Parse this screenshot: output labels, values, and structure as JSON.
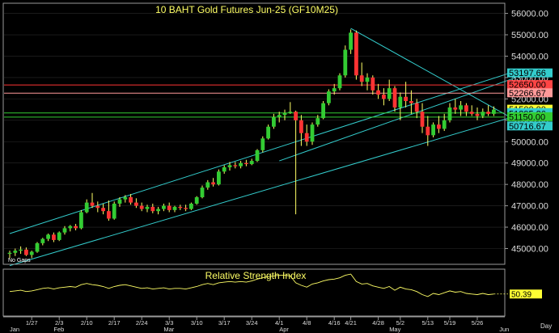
{
  "colors": {
    "background": "#000000",
    "frame": "#9a9a9a",
    "grid": "#2a2a2a",
    "title": "#ffff66",
    "up": "#33cc33",
    "down": "#ff3333",
    "wick": "#ffff66",
    "channel": "#33cccc",
    "rsi": "#ffff66",
    "axisText": "#dddddd",
    "badgeCyan": "#33cccc",
    "badgeRed": "#ff4444",
    "badgePink": "#ff9999",
    "badgeYellow": "#ffff33",
    "badgeGreen": "#33cc33"
  },
  "chart_data": {
    "type": "candlestick",
    "title": "10  BAHT  Gold  Futures  Jun-25  (GF10M25)",
    "corner_label": "No  Gaps",
    "ylim": [
      44300,
      56400
    ],
    "y_ticks": [
      45000,
      46000,
      47000,
      48000,
      49000,
      50000,
      51000,
      52000,
      53000,
      54000,
      55000,
      56000
    ],
    "y_tick_labels": [
      "45000.00",
      "46000.00",
      "47000.00",
      "48000.00",
      "49000.00",
      "50000.00",
      "51000.00",
      "52000.00",
      "53000.00",
      "54000.00",
      "55000.00",
      "56000.00"
    ],
    "x_ticks": [
      {
        "label": "1/27",
        "i": 4
      },
      {
        "label": "2/3",
        "i": 9
      },
      {
        "label": "2/10",
        "i": 14
      },
      {
        "label": "2/17",
        "i": 19
      },
      {
        "label": "2/24",
        "i": 24
      },
      {
        "label": "3/3",
        "i": 29
      },
      {
        "label": "3/10",
        "i": 34
      },
      {
        "label": "3/17",
        "i": 39
      },
      {
        "label": "3/24",
        "i": 44
      },
      {
        "label": "4/1",
        "i": 49
      },
      {
        "label": "4/8",
        "i": 54
      },
      {
        "label": "4/16",
        "i": 59
      },
      {
        "label": "4/21",
        "i": 62
      },
      {
        "label": "4/28",
        "i": 67
      },
      {
        "label": "5/2",
        "i": 71
      },
      {
        "label": "5/13",
        "i": 76
      },
      {
        "label": "5/19",
        "i": 80
      },
      {
        "label": "5/26",
        "i": 85
      }
    ],
    "month_labels": [
      {
        "label": "Jan",
        "i": 0
      },
      {
        "label": "Feb",
        "i": 8
      },
      {
        "label": "Mar",
        "i": 28
      },
      {
        "label": "Apr",
        "i": 49
      },
      {
        "label": "May",
        "i": 69
      },
      {
        "label": "Jun",
        "i": 89
      }
    ],
    "period_label": "Day",
    "candles": [
      {
        "o": 44750,
        "h": 44900,
        "l": 44550,
        "c": 44800
      },
      {
        "o": 44800,
        "h": 45000,
        "l": 44650,
        "c": 44900
      },
      {
        "o": 44900,
        "h": 45100,
        "l": 44750,
        "c": 44950
      },
      {
        "o": 44950,
        "h": 45050,
        "l": 44650,
        "c": 44700
      },
      {
        "o": 44700,
        "h": 44900,
        "l": 44550,
        "c": 44850
      },
      {
        "o": 44850,
        "h": 45300,
        "l": 44800,
        "c": 45250
      },
      {
        "o": 45250,
        "h": 45500,
        "l": 45150,
        "c": 45450
      },
      {
        "o": 45450,
        "h": 45700,
        "l": 45350,
        "c": 45650
      },
      {
        "o": 45650,
        "h": 45750,
        "l": 45300,
        "c": 45400
      },
      {
        "o": 45400,
        "h": 45800,
        "l": 45350,
        "c": 45750
      },
      {
        "o": 45750,
        "h": 46050,
        "l": 45650,
        "c": 45950
      },
      {
        "o": 45950,
        "h": 46100,
        "l": 45800,
        "c": 46050
      },
      {
        "o": 46050,
        "h": 46150,
        "l": 45850,
        "c": 45950
      },
      {
        "o": 45950,
        "h": 46800,
        "l": 45900,
        "c": 46700
      },
      {
        "o": 46700,
        "h": 47300,
        "l": 46650,
        "c": 47150
      },
      {
        "o": 47150,
        "h": 47600,
        "l": 46900,
        "c": 47000
      },
      {
        "o": 47000,
        "h": 47200,
        "l": 46700,
        "c": 46900
      },
      {
        "o": 46900,
        "h": 47100,
        "l": 46600,
        "c": 46750
      },
      {
        "o": 46750,
        "h": 47250,
        "l": 46300,
        "c": 46400
      },
      {
        "o": 46400,
        "h": 47200,
        "l": 46350,
        "c": 47100
      },
      {
        "o": 47100,
        "h": 47400,
        "l": 46950,
        "c": 47300
      },
      {
        "o": 47300,
        "h": 47500,
        "l": 47150,
        "c": 47400
      },
      {
        "o": 47400,
        "h": 47550,
        "l": 47050,
        "c": 47150
      },
      {
        "o": 47150,
        "h": 47350,
        "l": 46900,
        "c": 47000
      },
      {
        "o": 47000,
        "h": 47150,
        "l": 46750,
        "c": 46850
      },
      {
        "o": 46850,
        "h": 47050,
        "l": 46700,
        "c": 46950
      },
      {
        "o": 46950,
        "h": 47100,
        "l": 46650,
        "c": 46750
      },
      {
        "o": 46750,
        "h": 46950,
        "l": 46600,
        "c": 46850
      },
      {
        "o": 46850,
        "h": 47100,
        "l": 46750,
        "c": 47000
      },
      {
        "o": 47000,
        "h": 47150,
        "l": 46700,
        "c": 46800
      },
      {
        "o": 46800,
        "h": 47000,
        "l": 46700,
        "c": 46950
      },
      {
        "o": 46950,
        "h": 47050,
        "l": 46800,
        "c": 46900
      },
      {
        "o": 46900,
        "h": 47050,
        "l": 46750,
        "c": 46850
      },
      {
        "o": 46850,
        "h": 47150,
        "l": 46800,
        "c": 47100
      },
      {
        "o": 47100,
        "h": 47450,
        "l": 47050,
        "c": 47400
      },
      {
        "o": 47400,
        "h": 47950,
        "l": 47350,
        "c": 47850
      },
      {
        "o": 47850,
        "h": 48200,
        "l": 47750,
        "c": 48100
      },
      {
        "o": 48100,
        "h": 48300,
        "l": 47900,
        "c": 48000
      },
      {
        "o": 48000,
        "h": 48700,
        "l": 47950,
        "c": 48600
      },
      {
        "o": 48600,
        "h": 48900,
        "l": 48500,
        "c": 48800
      },
      {
        "o": 48800,
        "h": 49050,
        "l": 48650,
        "c": 48900
      },
      {
        "o": 48900,
        "h": 49050,
        "l": 48750,
        "c": 48850
      },
      {
        "o": 48850,
        "h": 49100,
        "l": 48750,
        "c": 49000
      },
      {
        "o": 49000,
        "h": 49150,
        "l": 48850,
        "c": 48950
      },
      {
        "o": 48950,
        "h": 49200,
        "l": 48900,
        "c": 49100
      },
      {
        "o": 49100,
        "h": 49650,
        "l": 49050,
        "c": 49600
      },
      {
        "o": 49600,
        "h": 50250,
        "l": 49500,
        "c": 50150
      },
      {
        "o": 50150,
        "h": 50800,
        "l": 50100,
        "c": 50700
      },
      {
        "o": 50700,
        "h": 51300,
        "l": 50600,
        "c": 51150
      },
      {
        "o": 51150,
        "h": 51400,
        "l": 50900,
        "c": 51250
      },
      {
        "o": 51250,
        "h": 51500,
        "l": 51000,
        "c": 51350
      },
      {
        "o": 51350,
        "h": 51850,
        "l": 51300,
        "c": 51400
      },
      {
        "o": 51400,
        "h": 51450,
        "l": 46600,
        "c": 51000
      },
      {
        "o": 51000,
        "h": 51250,
        "l": 49800,
        "c": 50400
      },
      {
        "o": 50400,
        "h": 50800,
        "l": 49800,
        "c": 50000
      },
      {
        "o": 50000,
        "h": 50900,
        "l": 49850,
        "c": 50800
      },
      {
        "o": 50800,
        "h": 51250,
        "l": 50700,
        "c": 51100
      },
      {
        "o": 51100,
        "h": 51900,
        "l": 51050,
        "c": 51800
      },
      {
        "o": 51800,
        "h": 52450,
        "l": 51700,
        "c": 52350
      },
      {
        "o": 52350,
        "h": 52700,
        "l": 52200,
        "c": 52500
      },
      {
        "o": 52500,
        "h": 53200,
        "l": 52400,
        "c": 53100
      },
      {
        "o": 53100,
        "h": 54500,
        "l": 53000,
        "c": 54300
      },
      {
        "o": 54300,
        "h": 55250,
        "l": 54100,
        "c": 55100
      },
      {
        "o": 55100,
        "h": 55200,
        "l": 52900,
        "c": 53100
      },
      {
        "o": 53100,
        "h": 53700,
        "l": 52600,
        "c": 52800
      },
      {
        "o": 52800,
        "h": 53200,
        "l": 52400,
        "c": 53000
      },
      {
        "o": 53000,
        "h": 53100,
        "l": 52200,
        "c": 52400
      },
      {
        "o": 52400,
        "h": 52700,
        "l": 52000,
        "c": 52200
      },
      {
        "o": 52200,
        "h": 52500,
        "l": 51700,
        "c": 52000
      },
      {
        "o": 52000,
        "h": 52900,
        "l": 51900,
        "c": 52500
      },
      {
        "o": 52500,
        "h": 52600,
        "l": 51400,
        "c": 51600
      },
      {
        "o": 51600,
        "h": 52300,
        "l": 51000,
        "c": 52100
      },
      {
        "o": 52100,
        "h": 52800,
        "l": 51600,
        "c": 51900
      },
      {
        "o": 51900,
        "h": 52400,
        "l": 51300,
        "c": 51800
      },
      {
        "o": 51800,
        "h": 52000,
        "l": 51100,
        "c": 51400
      },
      {
        "o": 51400,
        "h": 51800,
        "l": 50400,
        "c": 50700
      },
      {
        "o": 50700,
        "h": 51200,
        "l": 49800,
        "c": 50300
      },
      {
        "o": 50300,
        "h": 50900,
        "l": 50200,
        "c": 50800
      },
      {
        "o": 50800,
        "h": 51200,
        "l": 50400,
        "c": 50600
      },
      {
        "o": 50600,
        "h": 51300,
        "l": 50500,
        "c": 51000
      },
      {
        "o": 51000,
        "h": 51800,
        "l": 50900,
        "c": 51600
      },
      {
        "o": 51600,
        "h": 52000,
        "l": 51300,
        "c": 51500
      },
      {
        "o": 51500,
        "h": 51900,
        "l": 51200,
        "c": 51700
      },
      {
        "o": 51700,
        "h": 51800,
        "l": 51200,
        "c": 51400
      },
      {
        "o": 51400,
        "h": 51700,
        "l": 51200,
        "c": 51300
      },
      {
        "o": 51300,
        "h": 51600,
        "l": 51000,
        "c": 51200
      },
      {
        "o": 51200,
        "h": 51550,
        "l": 51100,
        "c": 51400
      },
      {
        "o": 51400,
        "h": 51700,
        "l": 51200,
        "c": 51300
      },
      {
        "o": 51300,
        "h": 51650,
        "l": 51200,
        "c": 51500
      }
    ],
    "horizontal_lines": [
      {
        "value": 52650,
        "color": "#ff3333"
      },
      {
        "value": 52266.67,
        "color": "#ff9999"
      },
      {
        "value": 51342.73,
        "color": "#33cc33"
      },
      {
        "value": 51150,
        "color": "#33cc33"
      }
    ],
    "trend_lines": [
      {
        "from": {
          "i": 0,
          "v": 45700
        },
        "to": {
          "i": 92,
          "v": 53300
        }
      },
      {
        "from": {
          "i": 0,
          "v": 44200
        },
        "to": {
          "i": 92,
          "v": 51200
        }
      },
      {
        "from": {
          "i": 62,
          "v": 55300
        },
        "to": {
          "i": 92,
          "v": 51000
        }
      },
      {
        "from": {
          "i": 49,
          "v": 49100
        },
        "to": {
          "i": 92,
          "v": 53000
        }
      }
    ],
    "price_badges": [
      {
        "label": "53197.66",
        "value": 53197.66,
        "color": "#33cccc",
        "text": "#000000"
      },
      {
        "label": "52650.00",
        "value": 52650,
        "color": "#ff4444",
        "text": "#000000"
      },
      {
        "label": "52266.67",
        "value": 52266.67,
        "color": "#ff9999",
        "text": "#000000"
      },
      {
        "label": "51500.00",
        "value": 51500,
        "color": "#ffff33",
        "text": "#000000"
      },
      {
        "label": "51342.73",
        "value": 51342.73,
        "color": "#33cccc",
        "text": "#000000"
      },
      {
        "label": "51295.26",
        "value": 51295.26,
        "color": "#33cccc",
        "text": "#000000"
      },
      {
        "label": "51150.00",
        "value": 51150,
        "color": "#33cc33",
        "text": "#000000"
      },
      {
        "label": "50716.67",
        "value": 50716.67,
        "color": "#33cccc",
        "text": "#000000"
      }
    ],
    "rsi": {
      "title": "Relative  Strength  Index",
      "ylim": [
        20,
        90
      ],
      "current_label": "50.39",
      "values": [
        58,
        59,
        60,
        58,
        59,
        61,
        63,
        64,
        62,
        64,
        65,
        66,
        65,
        69,
        71,
        69,
        68,
        66,
        63,
        66,
        68,
        69,
        67,
        65,
        63,
        64,
        62,
        63,
        64,
        62,
        63,
        63,
        62,
        64,
        66,
        69,
        71,
        69,
        72,
        73,
        74,
        73,
        74,
        73,
        75,
        78,
        80,
        82,
        83,
        84,
        84,
        83,
        72,
        68,
        65,
        70,
        72,
        75,
        77,
        78,
        80,
        84,
        86,
        74,
        70,
        71,
        67,
        65,
        63,
        66,
        60,
        65,
        62,
        61,
        58,
        53,
        50,
        55,
        53,
        56,
        59,
        57,
        58,
        55,
        54,
        53,
        55,
        53,
        54
      ]
    }
  }
}
